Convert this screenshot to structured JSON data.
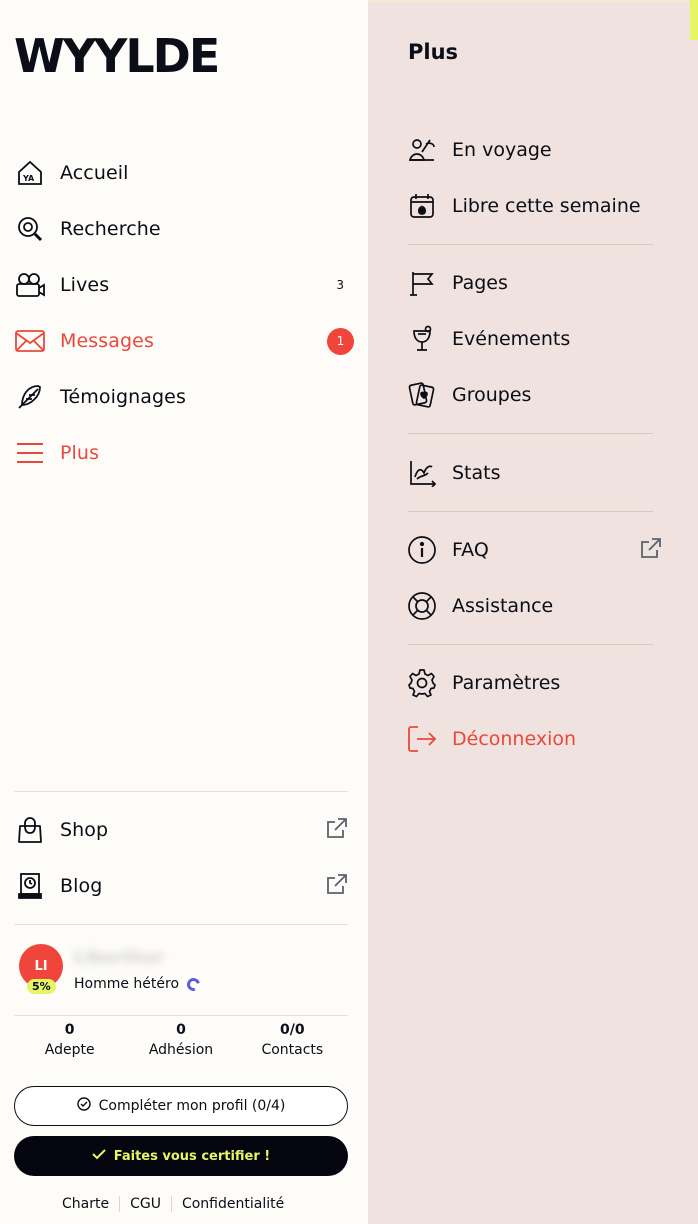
{
  "brand": {
    "logo": "WYYLDE"
  },
  "nav": {
    "items": [
      {
        "label": "Accueil",
        "icon": "home-icon"
      },
      {
        "label": "Recherche",
        "icon": "search-icon"
      },
      {
        "label": "Lives",
        "icon": "camera-icon",
        "count": "3"
      },
      {
        "label": "Messages",
        "icon": "envelope-icon",
        "badge": "1",
        "active": true
      },
      {
        "label": "Témoignages",
        "icon": "feather-icon"
      },
      {
        "label": "Plus",
        "icon": "menu-icon",
        "active": true
      }
    ],
    "external": [
      {
        "label": "Shop",
        "icon": "shopping-bag-icon"
      },
      {
        "label": "Blog",
        "icon": "book-icon"
      }
    ]
  },
  "profile": {
    "initials": "LI",
    "completion": "5%",
    "name": "Liberthur",
    "orientation": "Homme hétéro"
  },
  "stats": [
    {
      "value": "0",
      "label": "Adepte"
    },
    {
      "value": "0",
      "label": "Adhésion"
    },
    {
      "value": "0/0",
      "label": "Contacts"
    }
  ],
  "buttons": {
    "complete_profile": "Compléter mon profil (0/4)",
    "certify": "Faites vous certifier !"
  },
  "footer": {
    "links": [
      "Charte",
      "CGU",
      "Confidentialité"
    ]
  },
  "panel": {
    "title": "Plus",
    "groups": [
      [
        {
          "label": "En voyage",
          "icon": "travel-icon"
        },
        {
          "label": "Libre cette semaine",
          "icon": "calendar-fire-icon"
        }
      ],
      [
        {
          "label": "Pages",
          "icon": "flag-icon"
        },
        {
          "label": "Evénements",
          "icon": "cocktail-icon"
        },
        {
          "label": "Groupes",
          "icon": "cards-icon"
        }
      ],
      [
        {
          "label": "Stats",
          "icon": "chart-icon"
        }
      ],
      [
        {
          "label": "FAQ",
          "icon": "info-icon",
          "external": true
        },
        {
          "label": "Assistance",
          "icon": "lifebuoy-icon"
        }
      ],
      [
        {
          "label": "Paramètres",
          "icon": "gear-icon"
        },
        {
          "label": "Déconnexion",
          "icon": "logout-icon",
          "danger": true
        }
      ]
    ]
  },
  "colors": {
    "accent": "#e9493d",
    "dark": "#04050f",
    "lime": "#e5f564",
    "panel_bg": "#efe2df",
    "sidebar_bg": "#fdfcf8"
  }
}
